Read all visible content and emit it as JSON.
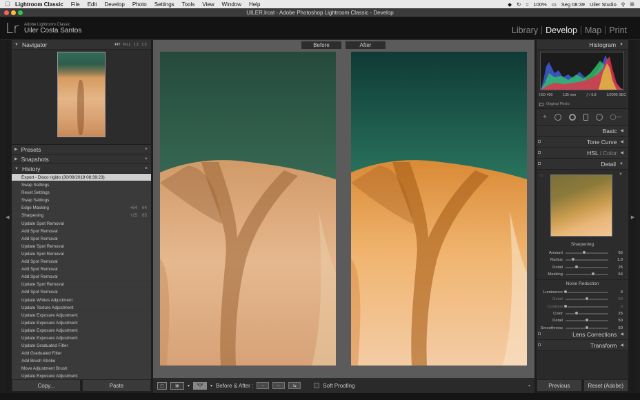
{
  "menubar": {
    "items": [
      "Lightroom Classic",
      "File",
      "Edit",
      "Develop",
      "Photo",
      "Settings",
      "Tools",
      "View",
      "Window",
      "Help"
    ],
    "battery": "100%",
    "clock": "Seg 08:39",
    "user": "Uiler Studio"
  },
  "window": {
    "title": "UILER.lrcat - Adobe Photoshop Lightroom Classic - Develop"
  },
  "identity": {
    "logo": "Lr",
    "product": "Adobe Lightroom Classic",
    "name": "Uiler Costa Santos"
  },
  "modules": [
    "Library",
    "Develop",
    "Map",
    "Print"
  ],
  "navigator": {
    "title": "Navigator",
    "zoom": [
      "FIT",
      "FILL",
      "1:1",
      "1:2"
    ]
  },
  "panels_left": {
    "presets": "Presets",
    "snapshots": "Snapshots",
    "history": "History",
    "add_symbol": "+",
    "close_symbol": "×"
  },
  "history_items": [
    {
      "label": "Export - Disco rígido (30/09/2019 08:39:23)",
      "v1": "",
      "v2": ""
    },
    {
      "label": "Swap Settings",
      "v1": "",
      "v2": ""
    },
    {
      "label": "Reset Settings",
      "v1": "",
      "v2": ""
    },
    {
      "label": "Swap Settings",
      "v1": "",
      "v2": ""
    },
    {
      "label": "Edge Masking",
      "v1": "+64",
      "v2": "64"
    },
    {
      "label": "Sharpening",
      "v1": "+25",
      "v2": "65"
    },
    {
      "label": "Update Spot Removal",
      "v1": "",
      "v2": ""
    },
    {
      "label": "Add Spot Removal",
      "v1": "",
      "v2": ""
    },
    {
      "label": "Add Spot Removal",
      "v1": "",
      "v2": ""
    },
    {
      "label": "Update Spot Removal",
      "v1": "",
      "v2": ""
    },
    {
      "label": "Update Spot Removal",
      "v1": "",
      "v2": ""
    },
    {
      "label": "Add Spot Removal",
      "v1": "",
      "v2": ""
    },
    {
      "label": "Add Spot Removal",
      "v1": "",
      "v2": ""
    },
    {
      "label": "Add Spot Removal",
      "v1": "",
      "v2": ""
    },
    {
      "label": "Update Spot Removal",
      "v1": "",
      "v2": ""
    },
    {
      "label": "Add Spot Removal",
      "v1": "",
      "v2": ""
    },
    {
      "label": "Update Whites Adjustment",
      "v1": "",
      "v2": ""
    },
    {
      "label": "Update Texture Adjustment",
      "v1": "",
      "v2": ""
    },
    {
      "label": "Update Exposure Adjustment",
      "v1": "",
      "v2": ""
    },
    {
      "label": "Update Exposure Adjustment",
      "v1": "",
      "v2": ""
    },
    {
      "label": "Update Exposure Adjustment",
      "v1": "",
      "v2": ""
    },
    {
      "label": "Update Exposure Adjustment",
      "v1": "",
      "v2": ""
    },
    {
      "label": "Update Graduated Filter",
      "v1": "",
      "v2": ""
    },
    {
      "label": "Add Graduated Filter",
      "v1": "",
      "v2": ""
    },
    {
      "label": "Add Brush Stroke",
      "v1": "",
      "v2": ""
    },
    {
      "label": "Move Adjustment Brush",
      "v1": "",
      "v2": ""
    },
    {
      "label": "Update Exposure Adjustment",
      "v1": "",
      "v2": ""
    }
  ],
  "left_buttons": {
    "copy": "Copy...",
    "paste": "Paste"
  },
  "compare": {
    "before": "Before",
    "after": "After"
  },
  "toolbar": {
    "before_after": "Before & After :",
    "soft_proofing": "Soft Proofing",
    "yy": "Y|Y"
  },
  "histogram": {
    "title": "Histogram",
    "iso": "ISO 400",
    "focal": "135 mm",
    "aperture": "ƒ / 6,8",
    "shutter": "1/2000 SEC",
    "original": "Original Photo"
  },
  "right_panels": {
    "basic": "Basic",
    "tone_curve": "Tone Curve",
    "hsl": "HSL",
    "color": "Color",
    "detail": "Detail",
    "lens": "Lens Corrections",
    "transform": "Transform"
  },
  "sharpening": {
    "title": "Sharpening",
    "sliders": [
      {
        "label": "Amount",
        "value": "65",
        "pos": 0.43
      },
      {
        "label": "Radius",
        "value": "1,0",
        "pos": 0.17
      },
      {
        "label": "Detail",
        "value": "25",
        "pos": 0.25
      },
      {
        "label": "Masking",
        "value": "64",
        "pos": 0.64
      }
    ]
  },
  "noise_reduction": {
    "title": "Noise Reduction",
    "sliders": [
      {
        "label": "Luminance",
        "value": "0",
        "pos": 0.0,
        "dim": false
      },
      {
        "label": "Detail",
        "value": "50",
        "pos": 0.5,
        "dim": true
      },
      {
        "label": "Contrast",
        "value": "0",
        "pos": 0.0,
        "dim": true
      },
      {
        "label": "Color",
        "value": "25",
        "pos": 0.25,
        "dim": false
      },
      {
        "label": "Detail",
        "value": "50",
        "pos": 0.5,
        "dim": false
      },
      {
        "label": "Smoothness",
        "value": "50",
        "pos": 0.5,
        "dim": false
      }
    ]
  },
  "right_buttons": {
    "previous": "Previous",
    "reset": "Reset (Adobe)"
  },
  "colors": {
    "menubar": "#e9e9e9",
    "panel": "#2a2a2a",
    "highlight": "#cfcfcf",
    "center_bg": "#5b5b5b"
  }
}
